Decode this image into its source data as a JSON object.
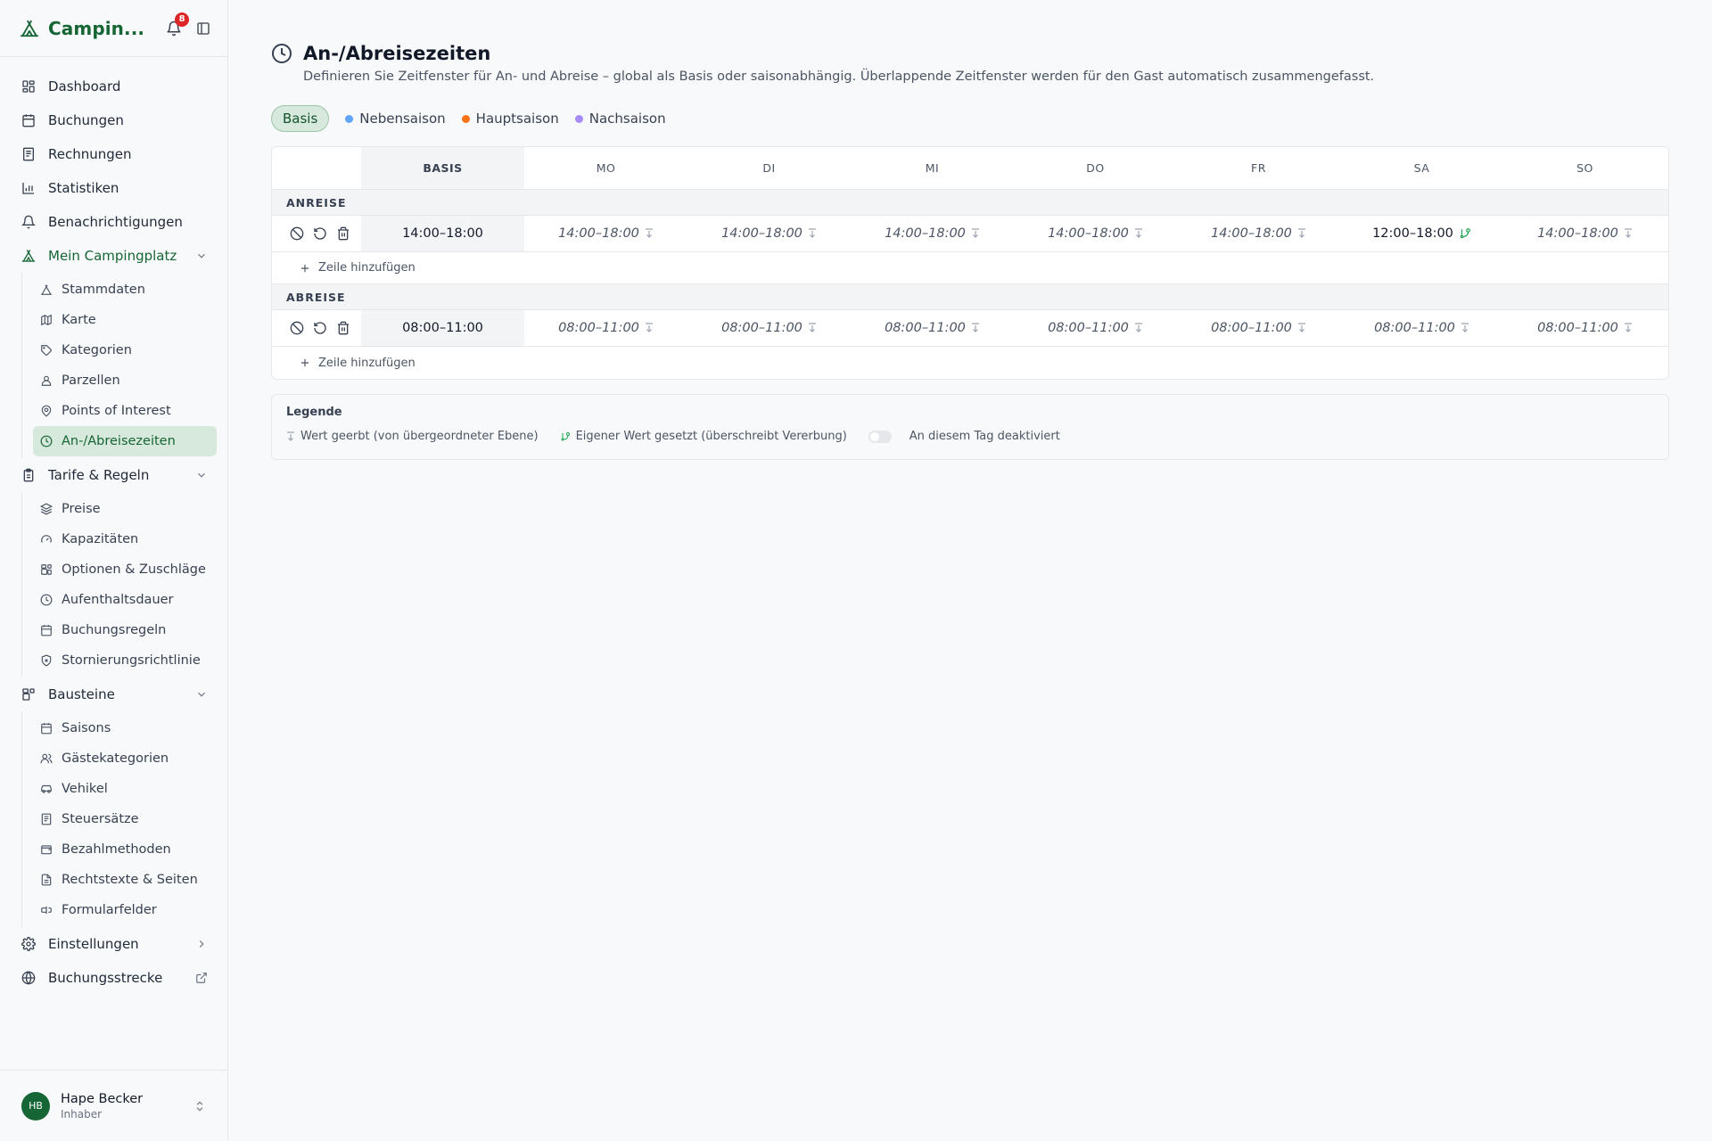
{
  "app": {
    "title": "Campin...",
    "notifications": "8"
  },
  "sidebar": {
    "top_items": [
      {
        "label": "Dashboard",
        "icon": "grid-icon"
      },
      {
        "label": "Buchungen",
        "icon": "calendar-icon"
      },
      {
        "label": "Rechnungen",
        "icon": "receipt-icon"
      },
      {
        "label": "Statistiken",
        "icon": "bar-chart-icon"
      },
      {
        "label": "Benachrichtigungen",
        "icon": "bell-icon"
      }
    ],
    "group_camp": {
      "label": "Mein Campingplatz",
      "items": [
        {
          "label": "Stammdaten"
        },
        {
          "label": "Karte"
        },
        {
          "label": "Kategorien"
        },
        {
          "label": "Parzellen"
        },
        {
          "label": "Points of Interest"
        },
        {
          "label": "An-/Abreisezeiten"
        }
      ]
    },
    "group_tariffs": {
      "label": "Tarife & Regeln",
      "items": [
        {
          "label": "Preise"
        },
        {
          "label": "Kapazitäten"
        },
        {
          "label": "Optionen & Zuschläge"
        },
        {
          "label": "Aufenthaltsdauer"
        },
        {
          "label": "Buchungsregeln"
        },
        {
          "label": "Stornierungsrichtlinie"
        }
      ]
    },
    "group_blocks": {
      "label": "Bausteine",
      "items": [
        {
          "label": "Saisons"
        },
        {
          "label": "Gästekategorien"
        },
        {
          "label": "Vehikel"
        },
        {
          "label": "Steuersätze"
        },
        {
          "label": "Bezahlmethoden"
        },
        {
          "label": "Rechtstexte & Seiten"
        },
        {
          "label": "Formularfelder"
        }
      ]
    },
    "settings_label": "Einstellungen",
    "booking_label": "Buchungsstrecke",
    "user": {
      "initials": "HB",
      "name": "Hape Becker",
      "role": "Inhaber"
    }
  },
  "page": {
    "title": "An-/Abreisezeiten",
    "description": "Definieren Sie Zeitfenster für An- und Abreise – global als Basis oder saisonabhängig. Überlappende Zeitfenster werden für den Gast automatisch zusammengefasst."
  },
  "tabs": [
    {
      "label": "Basis",
      "color": ""
    },
    {
      "label": "Nebensaison",
      "color": "#60a5fa"
    },
    {
      "label": "Hauptsaison",
      "color": "#f97316"
    },
    {
      "label": "Nachsaison",
      "color": "#a78bfa"
    }
  ],
  "grid": {
    "headers": [
      "BASIS",
      "MO",
      "DI",
      "MI",
      "DO",
      "FR",
      "SA",
      "SO"
    ],
    "arrival": {
      "label": "ANREISE",
      "basis": "14:00–18:00",
      "days": [
        {
          "value": "14:00–18:00",
          "state": "inherited"
        },
        {
          "value": "14:00–18:00",
          "state": "inherited"
        },
        {
          "value": "14:00–18:00",
          "state": "inherited"
        },
        {
          "value": "14:00–18:00",
          "state": "inherited"
        },
        {
          "value": "14:00–18:00",
          "state": "inherited"
        },
        {
          "value": "12:00–18:00",
          "state": "own"
        },
        {
          "value": "14:00–18:00",
          "state": "inherited"
        }
      ]
    },
    "departure": {
      "label": "ABREISE",
      "basis": "08:00–11:00",
      "days": [
        {
          "value": "08:00–11:00",
          "state": "inherited"
        },
        {
          "value": "08:00–11:00",
          "state": "inherited"
        },
        {
          "value": "08:00–11:00",
          "state": "inherited"
        },
        {
          "value": "08:00–11:00",
          "state": "inherited"
        },
        {
          "value": "08:00–11:00",
          "state": "inherited"
        },
        {
          "value": "08:00–11:00",
          "state": "inherited"
        },
        {
          "value": "08:00–11:00",
          "state": "inherited"
        }
      ]
    },
    "add_row_label": "Zeile hinzufügen"
  },
  "legend": {
    "title": "Legende",
    "inherited": "Wert geerbt (von übergeordneter Ebene)",
    "own": "Eigener Wert gesetzt (überschreibt Vererbung)",
    "disabled": "An diesem Tag deaktiviert"
  },
  "colors": {
    "brand": "#166534",
    "active_bg": "#d7e8dc",
    "badge": "#dc2626"
  }
}
